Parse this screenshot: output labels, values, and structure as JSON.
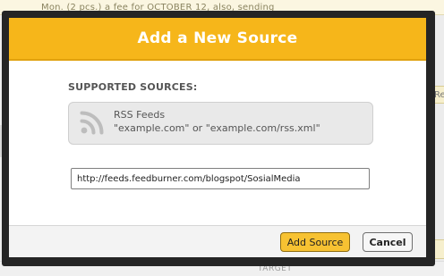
{
  "background": {
    "top_text": "Mon. (2 pcs.) a fee for OCTOBER 12, also, sending",
    "side_tab_fragment": "Re",
    "bottom_text": "TARGET"
  },
  "modal": {
    "title": "Add a New Source",
    "section_label": "SUPPORTED SOURCES:",
    "source": {
      "icon": "rss-icon",
      "name": "RSS Feeds",
      "description": "\"example.com\" or \"example.com/rss.xml\""
    },
    "url_input": {
      "value": "http://feeds.feedburner.com/blogspot/SosialMedia",
      "placeholder": ""
    },
    "buttons": {
      "add": "Add Source",
      "cancel": "Cancel"
    }
  },
  "colors": {
    "header": "#f6b61a",
    "add_button": "#f7c232",
    "overlay": "#252525"
  }
}
